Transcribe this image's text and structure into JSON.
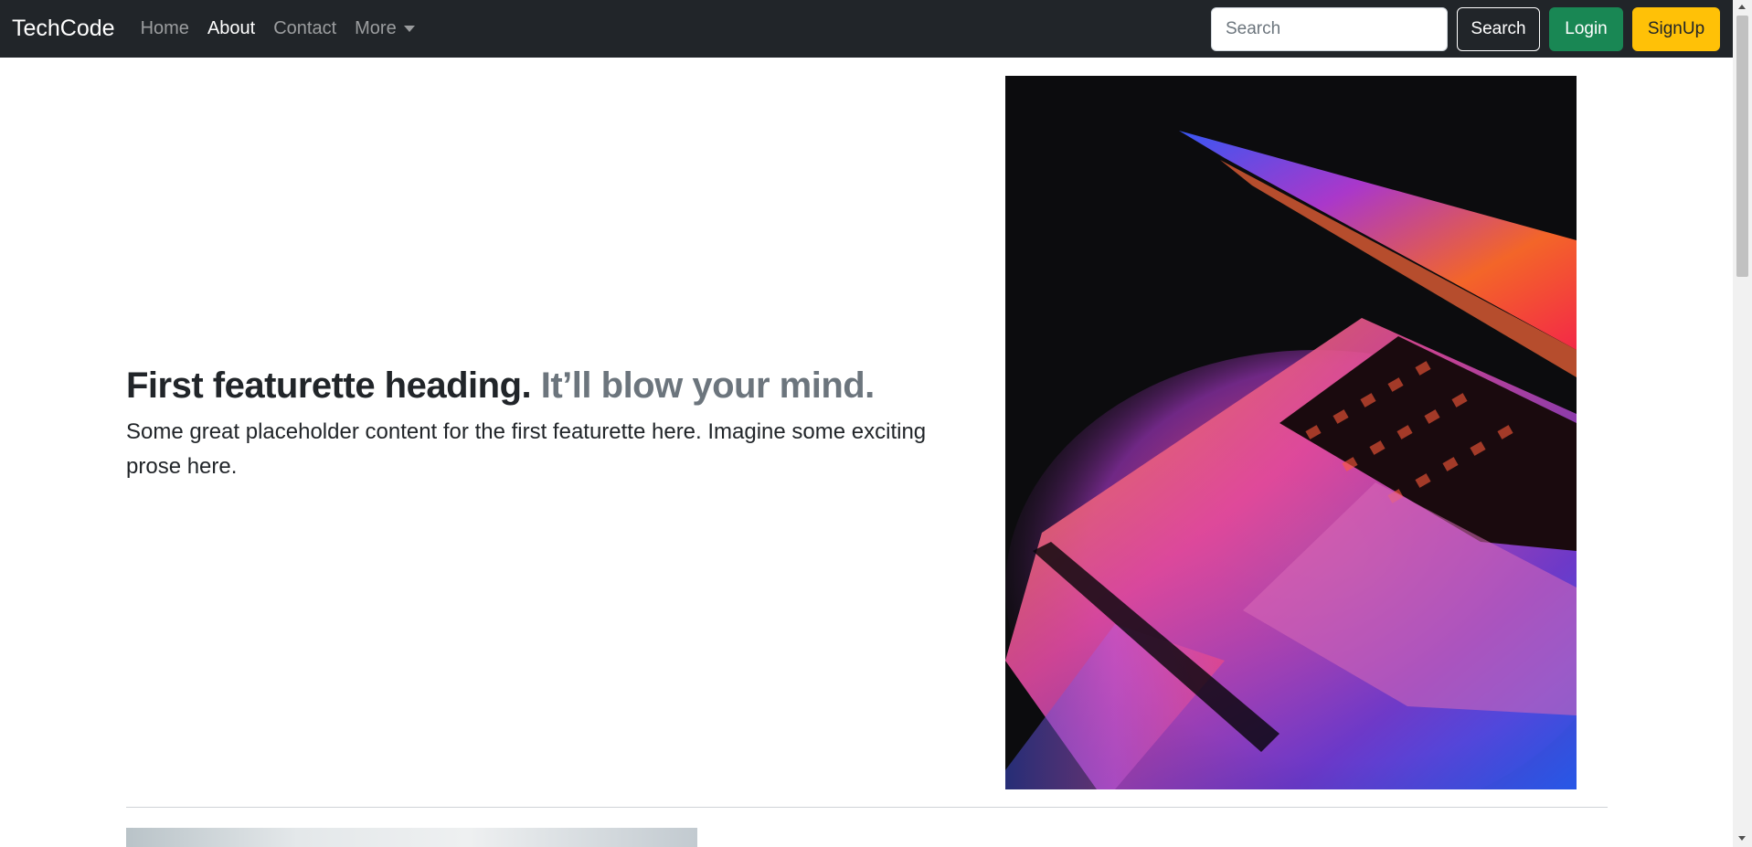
{
  "navbar": {
    "brand": "TechCode",
    "links": [
      {
        "label": "Home"
      },
      {
        "label": "About"
      },
      {
        "label": "Contact"
      },
      {
        "label": "More"
      }
    ],
    "search": {
      "placeholder": "Search",
      "value": ""
    },
    "search_button": "Search",
    "login_button": "Login",
    "signup_button": "SignUp"
  },
  "featurette": {
    "heading": "First featurette heading.",
    "heading_muted": "It’ll blow your mind.",
    "lead": "Some great placeholder content for the first featurette here. Imagine some exciting prose here.",
    "image_icon": "laptop-keyboard-photo"
  },
  "colors": {
    "navbar_bg": "#212529",
    "login_btn": "#198754",
    "signup_btn": "#ffc107",
    "muted_text": "#6c757d"
  }
}
